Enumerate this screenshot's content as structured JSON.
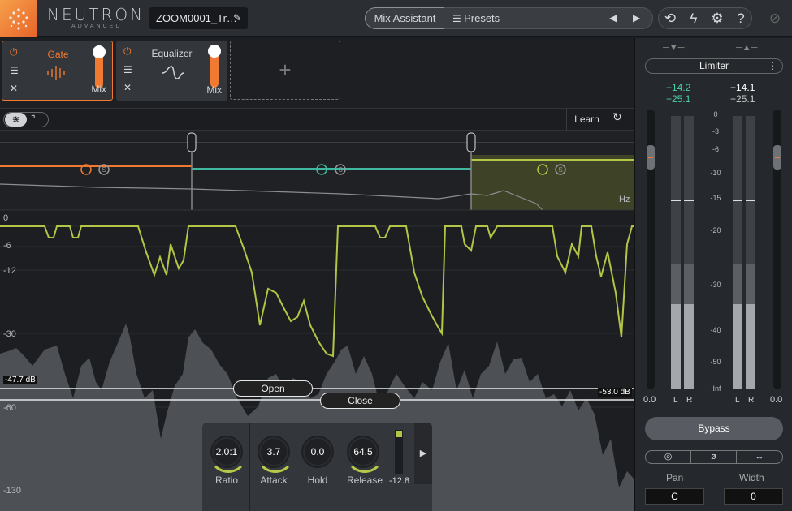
{
  "header": {
    "brand": "NEUTRON",
    "brand_sub": "ADVANCED",
    "preset_name": "ZOOM0001_Tr…",
    "mix_assistant": "Mix Assistant",
    "presets": "Presets"
  },
  "modules": [
    {
      "name": "Gate",
      "mix": "Mix",
      "active": true
    },
    {
      "name": "Equalizer",
      "mix": "Mix",
      "active": false
    }
  ],
  "bandbar": {
    "learn": "Learn",
    "hz": "Hz"
  },
  "db_scale": [
    "0",
    "-6",
    "-12",
    "-30",
    "-60",
    "-130"
  ],
  "thresholds": {
    "open": "Open",
    "close": "Close",
    "open_db": "-47.7 dB",
    "close_db": "-53.0 dB"
  },
  "controls": {
    "ratio": {
      "label": "Ratio",
      "value": "2.0:1"
    },
    "attack": {
      "label": "Attack",
      "value": "3.7"
    },
    "hold": {
      "label": "Hold",
      "value": "0.0"
    },
    "release": {
      "label": "Release",
      "value": "64.5"
    },
    "meter_value": "-12.8"
  },
  "sidebar": {
    "limiter": "Limiter",
    "in_peak": "−14.2",
    "in_rms": "−25.1",
    "out_peak": "−14.1",
    "out_rms": "−25.1",
    "scale": [
      "0",
      "-3",
      "-6",
      "-10",
      "-15",
      "-20",
      "-30",
      "-40",
      "-50",
      "-Inf"
    ],
    "left_gain": "0.0",
    "right_gain": "0.0",
    "l": "L",
    "r": "R",
    "bypass": "Bypass",
    "pan_label": "Pan",
    "width_label": "Width",
    "pan_value": "C",
    "width_value": "0"
  },
  "colors": {
    "accent": "#f07a32",
    "gate_curve": "#b4c545",
    "band_teal": "#3fb7a1"
  }
}
